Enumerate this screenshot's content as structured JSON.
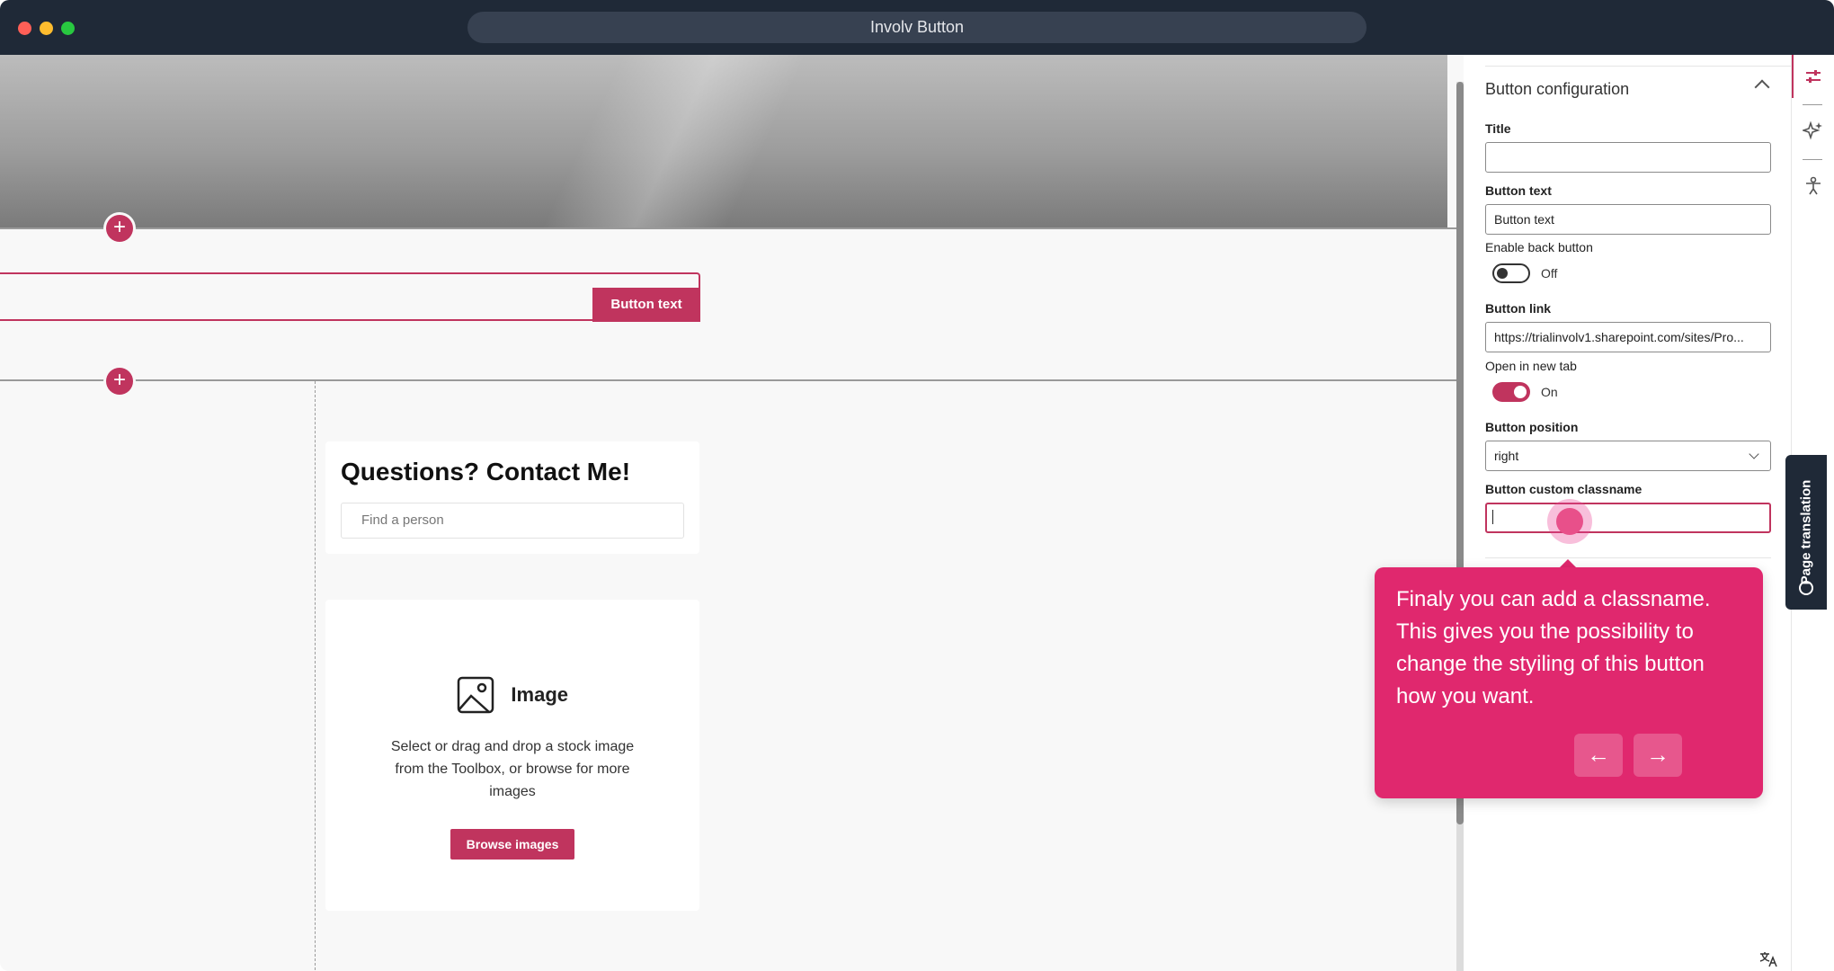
{
  "window": {
    "title": "Involv Button",
    "traffic_lights": {
      "close": "#ff5f57",
      "minimize": "#febc2e",
      "maximize": "#28c840"
    }
  },
  "canvas": {
    "add_section_icon": "+",
    "button_webpart": {
      "button_label": "Button text"
    },
    "contact_card": {
      "title": "Questions? Contact Me!",
      "search_placeholder": "Find a person"
    },
    "image_card": {
      "label": "Image",
      "description": "Select or drag and drop a stock image from the Toolbox, or browse for more images",
      "browse_label": "Browse images"
    }
  },
  "panel": {
    "section_title": "Button configuration",
    "fields": {
      "title": {
        "label": "Title",
        "value": ""
      },
      "button_text": {
        "label": "Button text",
        "value": "Button text"
      },
      "enable_back": {
        "label": "Enable back button",
        "state": "Off"
      },
      "button_link": {
        "label": "Button link",
        "value": "https://trialinvolv1.sharepoint.com/sites/Pro..."
      },
      "open_new_tab": {
        "label": "Open in new tab",
        "state": "On"
      },
      "button_position": {
        "label": "Button position",
        "value": "right"
      },
      "custom_classname": {
        "label": "Button custom classname",
        "value": ""
      }
    }
  },
  "rail": {
    "icons": [
      "sliders-icon",
      "sparkle-icon",
      "accessibility-icon"
    ],
    "page_translation": "Page translation"
  },
  "tooltip": {
    "text": "Finaly you can add a classname. This gives you the possibility to change the styiling of this button how you want.",
    "prev_icon": "←",
    "next_icon": "→"
  },
  "colors": {
    "accent": "#c0345e",
    "tooltip": "#e0286e",
    "titlebar": "#1f2937"
  }
}
